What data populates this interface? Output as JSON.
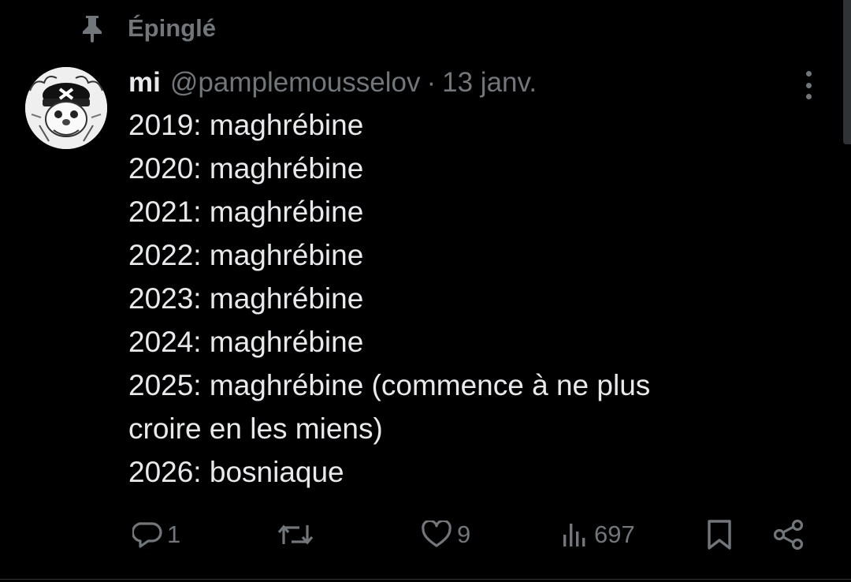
{
  "pinned": {
    "label": "Épinglé",
    "icon": "pin-icon"
  },
  "tweet": {
    "author": {
      "display_name": "mi",
      "handle": "@pamplemousselov",
      "avatar_icon": "avatar-image"
    },
    "separator": "·",
    "date": "13 janv.",
    "lines": [
      "2019: maghrébine",
      "2020: maghrébine",
      "2021: maghrébine",
      "2022: maghrébine",
      "2023: maghrébine",
      "2024: maghrébine",
      "2025: maghrébine (commence à ne plus",
      "croire en les miens)",
      "2026: bosniaque"
    ],
    "actions": {
      "reply": {
        "icon": "reply-icon",
        "count": "1"
      },
      "retweet": {
        "icon": "retweet-icon",
        "count": ""
      },
      "like": {
        "icon": "heart-icon",
        "count": "9"
      },
      "views": {
        "icon": "views-icon",
        "count": "697"
      },
      "bookmark": {
        "icon": "bookmark-icon"
      },
      "share": {
        "icon": "share-icon"
      }
    }
  },
  "colors": {
    "background": "#000000",
    "text_primary": "#e7e9ea",
    "text_secondary": "#71767b",
    "divider": "#2f3336"
  }
}
